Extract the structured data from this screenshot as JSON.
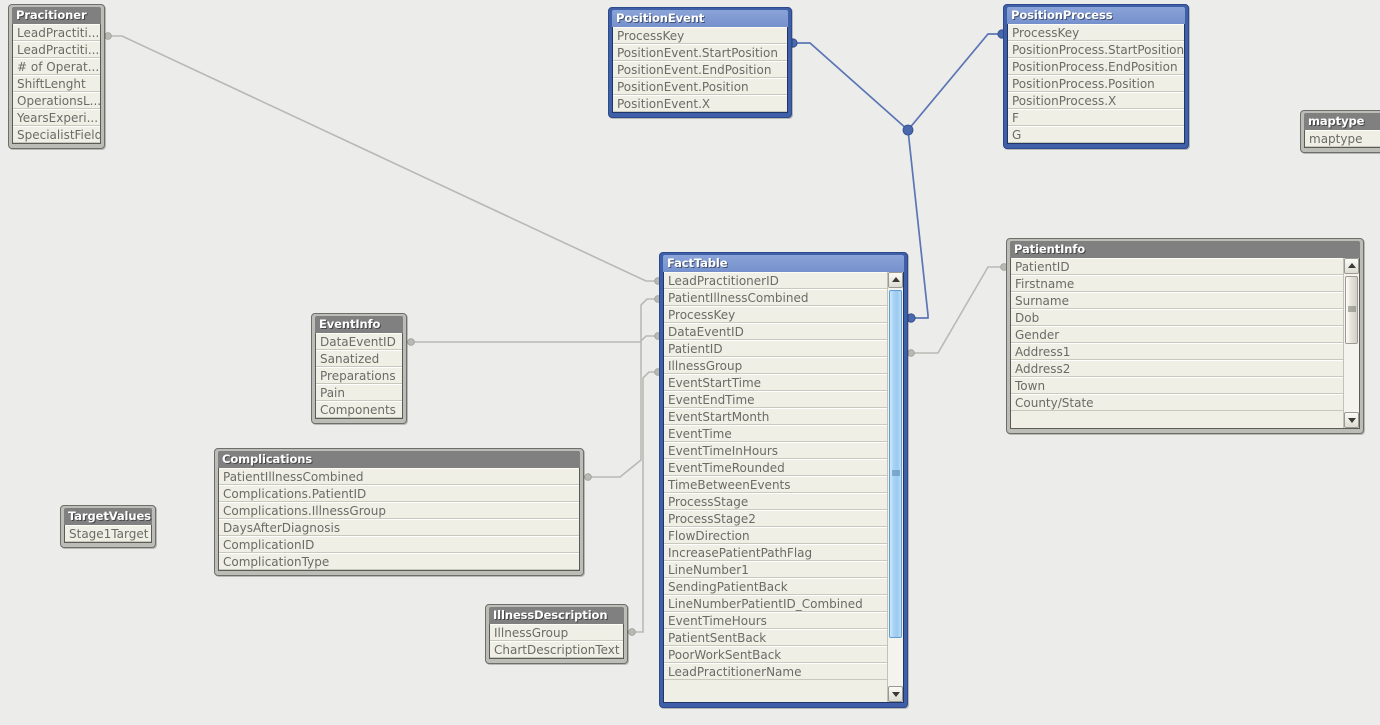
{
  "app": {
    "canvas_background": "#ececea",
    "selected_header_color": "#7a95d0",
    "unselected_header_color": "#808080",
    "row_background": "#f0efe6",
    "row_text_color": "#6b6b66",
    "selected_link_color": "#5b76b5",
    "link_color": "#b9b9b4"
  },
  "tables": [
    {
      "id": "pracitioner",
      "title": "Pracitioner",
      "selected": false,
      "scrollbar": null,
      "fields": [
        "LeadPractiti...",
        "LeadPractiti...",
        "# of Operat...",
        "ShiftLenght",
        "OperationsL...",
        "YearsExperi...",
        "SpecialistField"
      ]
    },
    {
      "id": "positionevent",
      "title": "PositionEvent",
      "selected": true,
      "scrollbar": null,
      "fields": [
        "ProcessKey",
        "PositionEvent.StartPosition",
        "PositionEvent.EndPosition",
        "PositionEvent.Position",
        "PositionEvent.X"
      ]
    },
    {
      "id": "positionprocess",
      "title": "PositionProcess",
      "selected": true,
      "scrollbar": null,
      "fields": [
        "ProcessKey",
        "PositionProcess.StartPosition",
        "PositionProcess.EndPosition",
        "PositionProcess.Position",
        "PositionProcess.X",
        "F",
        "G"
      ]
    },
    {
      "id": "maptype",
      "title": "maptype",
      "selected": false,
      "scrollbar": null,
      "fields": [
        "maptype"
      ]
    },
    {
      "id": "eventinfo",
      "title": "EventInfo",
      "selected": false,
      "scrollbar": null,
      "fields": [
        "DataEventID",
        "Sanatized",
        "Preparations",
        "Pain",
        "Components"
      ]
    },
    {
      "id": "complications",
      "title": "Complications",
      "selected": false,
      "scrollbar": null,
      "fields": [
        "PatientIllnessCombined",
        "Complications.PatientID",
        "Complications.IllnessGroup",
        "DaysAfterDiagnosis",
        "ComplicationID",
        "ComplicationType"
      ]
    },
    {
      "id": "targetvalues",
      "title": "TargetValues",
      "selected": false,
      "scrollbar": null,
      "fields": [
        "Stage1Target"
      ]
    },
    {
      "id": "illnessdescription",
      "title": "IllnessDescription",
      "selected": false,
      "scrollbar": null,
      "fields": [
        "IllnessGroup",
        "ChartDescriptionText"
      ]
    },
    {
      "id": "facttable",
      "title": "FactTable",
      "selected": true,
      "scrollbar": "blue",
      "fields": [
        "LeadPractitionerID",
        "PatientIllnessCombined",
        "ProcessKey",
        "DataEventID",
        "PatientID",
        "IllnessGroup",
        "EventStartTime",
        "EventEndTime",
        "EventStartMonth",
        "EventTime",
        "EventTimeInHours",
        "EventTimeRounded",
        "TimeBetweenEvents",
        "ProcessStage",
        "ProcessStage2",
        "FlowDirection",
        "IncreasePatientPathFlag",
        "LineNumber1",
        "SendingPatientBack",
        "LineNumberPatientID_Combined",
        "EventTimeHours",
        "PatientSentBack",
        "PoorWorkSentBack",
        "LeadPractitionerName"
      ]
    },
    {
      "id": "patientinfo",
      "title": "PatientInfo",
      "selected": false,
      "scrollbar": "gray",
      "fields": [
        "PatientID",
        "Firstname",
        "Surname",
        "Dob",
        "Gender",
        "Address1",
        "Address2",
        "Town",
        "County/State"
      ]
    }
  ]
}
